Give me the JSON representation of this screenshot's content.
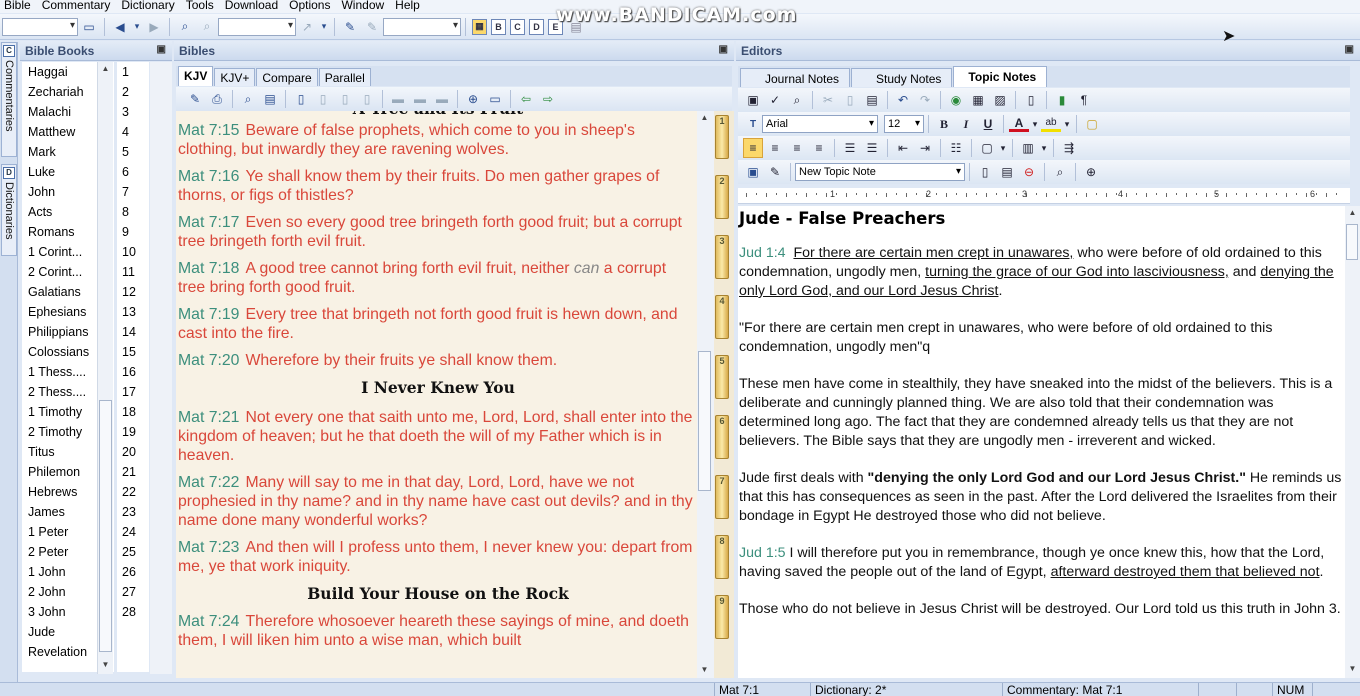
{
  "menubar": [
    "Bible",
    "Commentary",
    "Dictionary",
    "Tools",
    "Download",
    "Options",
    "Window",
    "Help"
  ],
  "watermark": "www.BANDICAM.com",
  "vtabs": {
    "commentaries": "Commentaries",
    "dictionaries": "Dictionaries"
  },
  "panels": {
    "bible_books": "Bible Books",
    "bibles": "Bibles",
    "editors": "Editors"
  },
  "books": [
    "Haggai",
    "Zechariah",
    "Malachi",
    "Matthew",
    "Mark",
    "Luke",
    "John",
    "Acts",
    "Romans",
    "1 Corint...",
    "2 Corint...",
    "Galatians",
    "Ephesians",
    "Philippians",
    "Colossians",
    "1 Thess....",
    "2 Thess....",
    "1 Timothy",
    "2 Timothy",
    "Titus",
    "Philemon",
    "Hebrews",
    "James",
    "1 Peter",
    "2 Peter",
    "1 John",
    "2 John",
    "3 John",
    "Jude",
    "Revelation"
  ],
  "chapters": [
    "1",
    "2",
    "3",
    "4",
    "5",
    "6",
    "7",
    "8",
    "9",
    "10",
    "11",
    "12",
    "13",
    "14",
    "15",
    "16",
    "17",
    "18",
    "19",
    "20",
    "21",
    "22",
    "23",
    "24",
    "25",
    "26",
    "27",
    "28"
  ],
  "bible_tabs": [
    "KJV",
    "KJV+",
    "Compare",
    "Parallel"
  ],
  "bible": {
    "partial_heading": "A Tree and Its Fruit",
    "verses_a": [
      {
        "ref": "Mat 7:15",
        "text": "Beware of false prophets, which come to you in sheep's clothing, but inwardly they are ravening wolves."
      },
      {
        "ref": "Mat 7:16",
        "text": "Ye shall know them by their fruits. Do men gather grapes of thorns, or figs of thistles?"
      },
      {
        "ref": "Mat 7:17",
        "text": "Even so every good tree bringeth forth good fruit; but a corrupt tree bringeth forth evil fruit."
      }
    ],
    "v18": {
      "ref": "Mat 7:18",
      "pre": "A good tree cannot bring forth evil fruit, neither ",
      "ital": "can",
      "post": " a corrupt tree bring forth good fruit."
    },
    "verses_b": [
      {
        "ref": "Mat 7:19",
        "text": "Every tree that bringeth not forth good fruit is hewn down, and cast into the fire."
      },
      {
        "ref": "Mat 7:20",
        "text": "Wherefore by their fruits ye shall know them."
      }
    ],
    "heading2": "I Never Knew You",
    "verses_c": [
      {
        "ref": "Mat 7:21",
        "text": "Not every one that saith unto me, Lord, Lord, shall enter into the kingdom of heaven; but he that doeth the will of my Father which is in heaven."
      },
      {
        "ref": "Mat 7:22",
        "text": "Many will say to me in that day, Lord, Lord, have we not prophesied in thy name? and in thy name have cast out devils? and in thy name done many wonderful works?"
      },
      {
        "ref": "Mat 7:23",
        "text": "And then will I profess unto them, I never knew you: depart from me, ye that work iniquity."
      }
    ],
    "heading3": "Build Your House on the Rock",
    "verses_d": [
      {
        "ref": "Mat 7:24",
        "text": "Therefore whosoever heareth these sayings of mine, and doeth them, I will liken him unto a wise man, which built"
      }
    ]
  },
  "chapter_markers": [
    "1",
    "2",
    "3",
    "4",
    "5",
    "6",
    "7",
    "8",
    "9"
  ],
  "editor_tabs": [
    "Journal Notes",
    "Study Notes",
    "Topic Notes"
  ],
  "editor_toolbar": {
    "font": "Arial",
    "size": "12",
    "topic_note": "New Topic Note"
  },
  "ruler_nums": [
    "1",
    "2",
    "3",
    "4",
    "5",
    "6"
  ],
  "doc": {
    "title": "Jude - False Preachers",
    "p1": {
      "ref": "Jud 1:4",
      "u1": "For there are certain men crept in unawares,",
      "t1": " who were before of old ordained to this condemnation, ungodly men, ",
      "u2": "turning the grace of our God into lasciviousness,",
      "t2": " and ",
      "u3": "denying the only Lord God, and our Lord Jesus Christ",
      "t3": "."
    },
    "p2": "\"For there are certain men crept in unawares, who were before of old ordained to this condemnation, ungodly men\"q",
    "p3": "These men have come in stealthily, they have sneaked into the midst of the believers. This is a deliberate and cunningly planned thing. We are also told that their condemnation was determined long ago. The fact that they are condemned already tells us that they are not believers. The Bible says that they are ungodly men - irreverent and wicked.",
    "p4": {
      "pre": "Jude first deals with ",
      "bold": "\"denying the only Lord God and our Lord Jesus Christ.\"",
      "post": " He reminds us that this has consequences as seen in the past. After the Lord delivered the Israelites from their bondage in Egypt He destroyed those who did not believe."
    },
    "p5": {
      "ref": "Jud 1:5",
      "t1": " I will therefore put you in remembrance, though ye once knew this, how that the Lord, having saved the people out of the land of Egypt, ",
      "u1": "afterward destroyed them that believed not",
      "t2": "."
    },
    "p6": "Those who do not believe in Jesus Christ will be destroyed. Our Lord told us this truth in John 3."
  },
  "status": {
    "ref": "Mat 7:1",
    "dictionary": "Dictionary: 2*",
    "commentary": "Commentary: Mat 7:1",
    "num": "NUM"
  }
}
